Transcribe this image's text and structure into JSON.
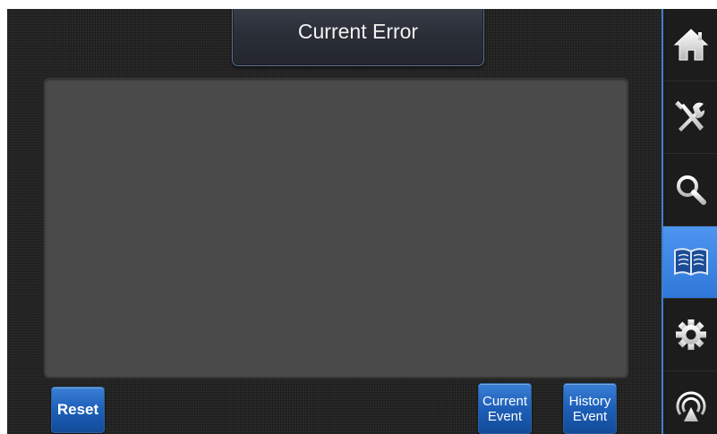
{
  "screen": {
    "title": "Current Error"
  },
  "buttons": {
    "reset": "Reset",
    "current_event": [
      "Current",
      "Event"
    ],
    "history_event": [
      "History",
      "Event"
    ]
  },
  "sidebar": {
    "items": [
      {
        "icon": "home-icon",
        "active": false
      },
      {
        "icon": "tools-icon",
        "active": false
      },
      {
        "icon": "search-icon",
        "active": false
      },
      {
        "icon": "book-icon",
        "active": true
      },
      {
        "icon": "gear-icon",
        "active": false
      },
      {
        "icon": "signal-icon",
        "active": false
      }
    ]
  },
  "colors": {
    "accent": "#3f7fd0",
    "button": "#1d5fb8",
    "panel": "#4a4a4a",
    "background": "#202020"
  }
}
